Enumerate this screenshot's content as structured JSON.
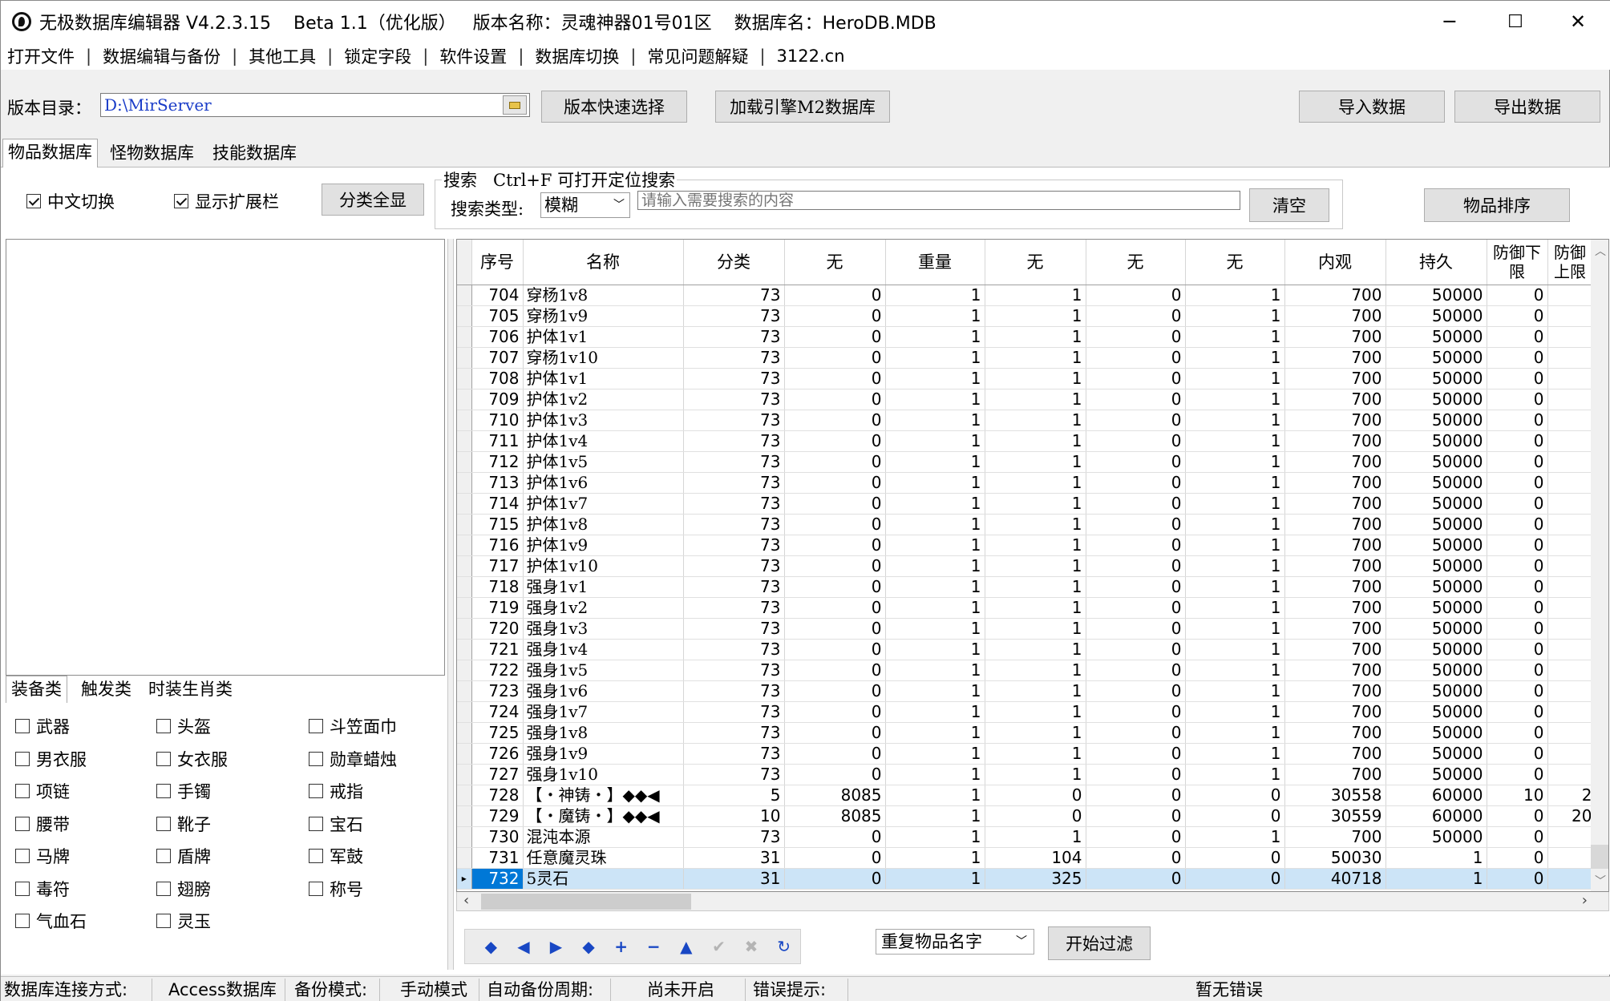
{
  "window": {
    "title": "无极数据库编辑器 V4.2.3.15    Beta 1.1（优化版）   版本名称：灵魂神器01号01区    数据库名：HeroDB.MDB",
    "minimize_glyph": "─",
    "maximize_glyph": "☐",
    "close_glyph": "✕"
  },
  "menu": [
    "打开文件",
    "数据编辑与备份",
    "其他工具",
    "锁定字段",
    "软件设置",
    "数据库切换",
    "常见问题解疑",
    "3122.cn"
  ],
  "menu_separator": "|",
  "toolbar": {
    "dir_label": "版本目录：",
    "dir_value": "D:\\MirServer",
    "quick_select": "版本快速选择",
    "load_m2": "加载引擎M2数据库",
    "import": "导入数据",
    "export": "导出数据"
  },
  "db_tabs": [
    "物品数据库",
    "怪物数据库",
    "技能数据库"
  ],
  "options": {
    "chinese_toggle": "中文切换",
    "show_ext": "显示扩展栏",
    "show_all_categories": "分类全显",
    "chinese_toggle_checked": true,
    "show_ext_checked": true
  },
  "search": {
    "title": "搜索   Ctrl+F 可打开定位搜索",
    "type_label": "搜索类型:",
    "type_value": "模糊",
    "placeholder": "请输入需要搜索的内容",
    "clear": "清空",
    "sort_items": "物品排序"
  },
  "category_tabs": [
    "装备类",
    "触发类",
    "时装生肖类"
  ],
  "categories": [
    [
      "武器",
      "头盔",
      "斗笠面巾"
    ],
    [
      "男衣服",
      "女衣服",
      "勋章蜡烛"
    ],
    [
      "项链",
      "手镯",
      "戒指"
    ],
    [
      "腰带",
      "靴子",
      "宝石"
    ],
    [
      "马牌",
      "盾牌",
      "军鼓"
    ],
    [
      "毒符",
      "翅膀",
      "称号"
    ],
    [
      "气血石",
      "灵玉"
    ]
  ],
  "grid": {
    "columns": [
      "序号",
      "名称",
      "分类",
      "无",
      "重量",
      "无",
      "无",
      "无",
      "内观",
      "持久",
      "防御下限",
      "防御上限"
    ],
    "rows": [
      [
        "704",
        "穿杨1v8",
        "73",
        "0",
        "1",
        "1",
        "0",
        "1",
        "700",
        "50000",
        "0",
        ""
      ],
      [
        "705",
        "穿杨1v9",
        "73",
        "0",
        "1",
        "1",
        "0",
        "1",
        "700",
        "50000",
        "0",
        ""
      ],
      [
        "706",
        "护体1v1",
        "73",
        "0",
        "1",
        "1",
        "0",
        "1",
        "700",
        "50000",
        "0",
        ""
      ],
      [
        "707",
        "穿杨1v10",
        "73",
        "0",
        "1",
        "1",
        "0",
        "1",
        "700",
        "50000",
        "0",
        ""
      ],
      [
        "708",
        "护体1v1",
        "73",
        "0",
        "1",
        "1",
        "0",
        "1",
        "700",
        "50000",
        "0",
        ""
      ],
      [
        "709",
        "护体1v2",
        "73",
        "0",
        "1",
        "1",
        "0",
        "1",
        "700",
        "50000",
        "0",
        ""
      ],
      [
        "710",
        "护体1v3",
        "73",
        "0",
        "1",
        "1",
        "0",
        "1",
        "700",
        "50000",
        "0",
        ""
      ],
      [
        "711",
        "护体1v4",
        "73",
        "0",
        "1",
        "1",
        "0",
        "1",
        "700",
        "50000",
        "0",
        ""
      ],
      [
        "712",
        "护体1v5",
        "73",
        "0",
        "1",
        "1",
        "0",
        "1",
        "700",
        "50000",
        "0",
        ""
      ],
      [
        "713",
        "护体1v6",
        "73",
        "0",
        "1",
        "1",
        "0",
        "1",
        "700",
        "50000",
        "0",
        ""
      ],
      [
        "714",
        "护体1v7",
        "73",
        "0",
        "1",
        "1",
        "0",
        "1",
        "700",
        "50000",
        "0",
        ""
      ],
      [
        "715",
        "护体1v8",
        "73",
        "0",
        "1",
        "1",
        "0",
        "1",
        "700",
        "50000",
        "0",
        ""
      ],
      [
        "716",
        "护体1v9",
        "73",
        "0",
        "1",
        "1",
        "0",
        "1",
        "700",
        "50000",
        "0",
        ""
      ],
      [
        "717",
        "护体1v10",
        "73",
        "0",
        "1",
        "1",
        "0",
        "1",
        "700",
        "50000",
        "0",
        ""
      ],
      [
        "718",
        "强身1v1",
        "73",
        "0",
        "1",
        "1",
        "0",
        "1",
        "700",
        "50000",
        "0",
        ""
      ],
      [
        "719",
        "强身1v2",
        "73",
        "0",
        "1",
        "1",
        "0",
        "1",
        "700",
        "50000",
        "0",
        ""
      ],
      [
        "720",
        "强身1v3",
        "73",
        "0",
        "1",
        "1",
        "0",
        "1",
        "700",
        "50000",
        "0",
        ""
      ],
      [
        "721",
        "强身1v4",
        "73",
        "0",
        "1",
        "1",
        "0",
        "1",
        "700",
        "50000",
        "0",
        ""
      ],
      [
        "722",
        "强身1v5",
        "73",
        "0",
        "1",
        "1",
        "0",
        "1",
        "700",
        "50000",
        "0",
        ""
      ],
      [
        "723",
        "强身1v6",
        "73",
        "0",
        "1",
        "1",
        "0",
        "1",
        "700",
        "50000",
        "0",
        ""
      ],
      [
        "724",
        "强身1v7",
        "73",
        "0",
        "1",
        "1",
        "0",
        "1",
        "700",
        "50000",
        "0",
        ""
      ],
      [
        "725",
        "强身1v8",
        "73",
        "0",
        "1",
        "1",
        "0",
        "1",
        "700",
        "50000",
        "0",
        ""
      ],
      [
        "726",
        "强身1v9",
        "73",
        "0",
        "1",
        "1",
        "0",
        "1",
        "700",
        "50000",
        "0",
        ""
      ],
      [
        "727",
        "强身1v10",
        "73",
        "0",
        "1",
        "1",
        "0",
        "1",
        "700",
        "50000",
        "0",
        ""
      ],
      [
        "728",
        "【・神铸・】◆◆◀",
        "5",
        "8085",
        "1",
        "0",
        "0",
        "0",
        "30558",
        "60000",
        "10",
        "2"
      ],
      [
        "729",
        "【・魔铸・】◆◆◀",
        "10",
        "8085",
        "1",
        "0",
        "0",
        "0",
        "30559",
        "60000",
        "0",
        "20"
      ],
      [
        "730",
        "混沌本源",
        "73",
        "0",
        "1",
        "1",
        "0",
        "1",
        "700",
        "50000",
        "0",
        ""
      ],
      [
        "731",
        "任意魔灵珠",
        "31",
        "0",
        "1",
        "104",
        "0",
        "0",
        "50030",
        "1",
        "0",
        ""
      ],
      [
        "732",
        "5灵石",
        "31",
        "0",
        "1",
        "325",
        "0",
        "0",
        "40718",
        "1",
        "0",
        ""
      ]
    ],
    "selected_row": "732"
  },
  "nav": [
    "◆",
    "◀",
    "▶",
    "◆",
    "+",
    "−",
    "▲",
    "✔",
    "✖",
    "↻"
  ],
  "filter": {
    "select_value": "重复物品名字",
    "start": "开始过滤"
  },
  "status": {
    "conn_label": "数据库连接方式:",
    "conn_value": "Access数据库",
    "backup_label": "备份模式:",
    "backup_value": "手动模式",
    "auto_label": "自动备份周期:",
    "auto_value": "尚未开启",
    "error_label": "错误提示:",
    "error_value": "暂无错误"
  },
  "colors": {
    "selection": "#0078d7",
    "selection_row": "#cce4f7",
    "path_text": "#1a3cc8",
    "nav_blue": "#1847c4"
  }
}
